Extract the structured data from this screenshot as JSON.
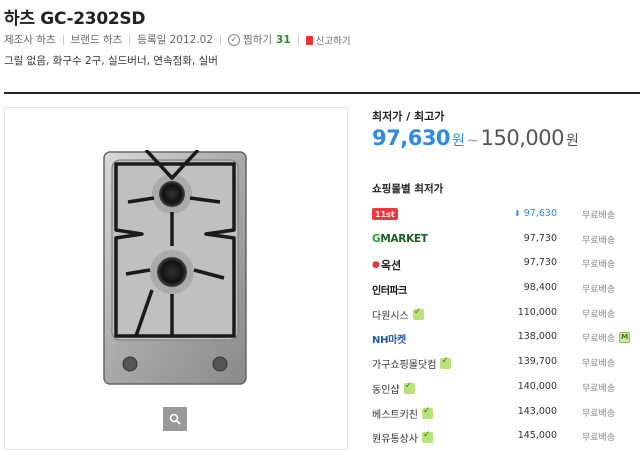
{
  "product": {
    "title": "하츠 GC-2302SD",
    "maker": "제조사 하츠",
    "brand": "브랜드 하츠",
    "registered": "등록일 2012.02",
    "wish_label": "찜하기",
    "wish_count": "31",
    "report_label": "신고하기",
    "specs": "그릴 없음, 화구수 2구, 실드버너, 연속점화, 실버"
  },
  "price": {
    "label": "최저가 / 최고가",
    "low": "97,630",
    "won": "원",
    "tilde": "~",
    "high": "150,000"
  },
  "malls": {
    "label": "쇼핑몰별 최저가",
    "rows": [
      {
        "name": "11st",
        "price": "97,630",
        "ship": "무료배송",
        "lowest": true
      },
      {
        "name": "Gmarket",
        "price": "97,730",
        "ship": "무료배송"
      },
      {
        "name": "옥션",
        "price": "97,730",
        "ship": "무료배송"
      },
      {
        "name": "인터파크",
        "price": "98,400",
        "ship": "무료배송"
      },
      {
        "name": "다원시스",
        "price": "110,000",
        "ship": "무료배송",
        "pay_icon": true
      },
      {
        "name": "NH마켓",
        "price": "138,000",
        "ship": "무료배송",
        "m_badge": true
      },
      {
        "name": "가구쇼핑몰닷컴",
        "price": "139,700",
        "ship": "무료배송",
        "pay_icon": true
      },
      {
        "name": "동인샵",
        "price": "140,000",
        "ship": "무료배송",
        "pay_icon": true
      },
      {
        "name": "베스트키친",
        "price": "143,000",
        "ship": "무료배송",
        "pay_icon": true
      },
      {
        "name": "원유통상사",
        "price": "145,000",
        "ship": "무료배송",
        "pay_icon": true
      }
    ]
  },
  "icons": {
    "wish": "check-circle-icon",
    "report": "lock-icon",
    "zoom": "magnifier-icon",
    "lowest": "down-arrow-icon",
    "pay": "payment-icon",
    "m": "m-badge-icon"
  },
  "colors": {
    "accent": "#2d8be0",
    "wish": "#2a8c2a",
    "report": "#e33333"
  }
}
